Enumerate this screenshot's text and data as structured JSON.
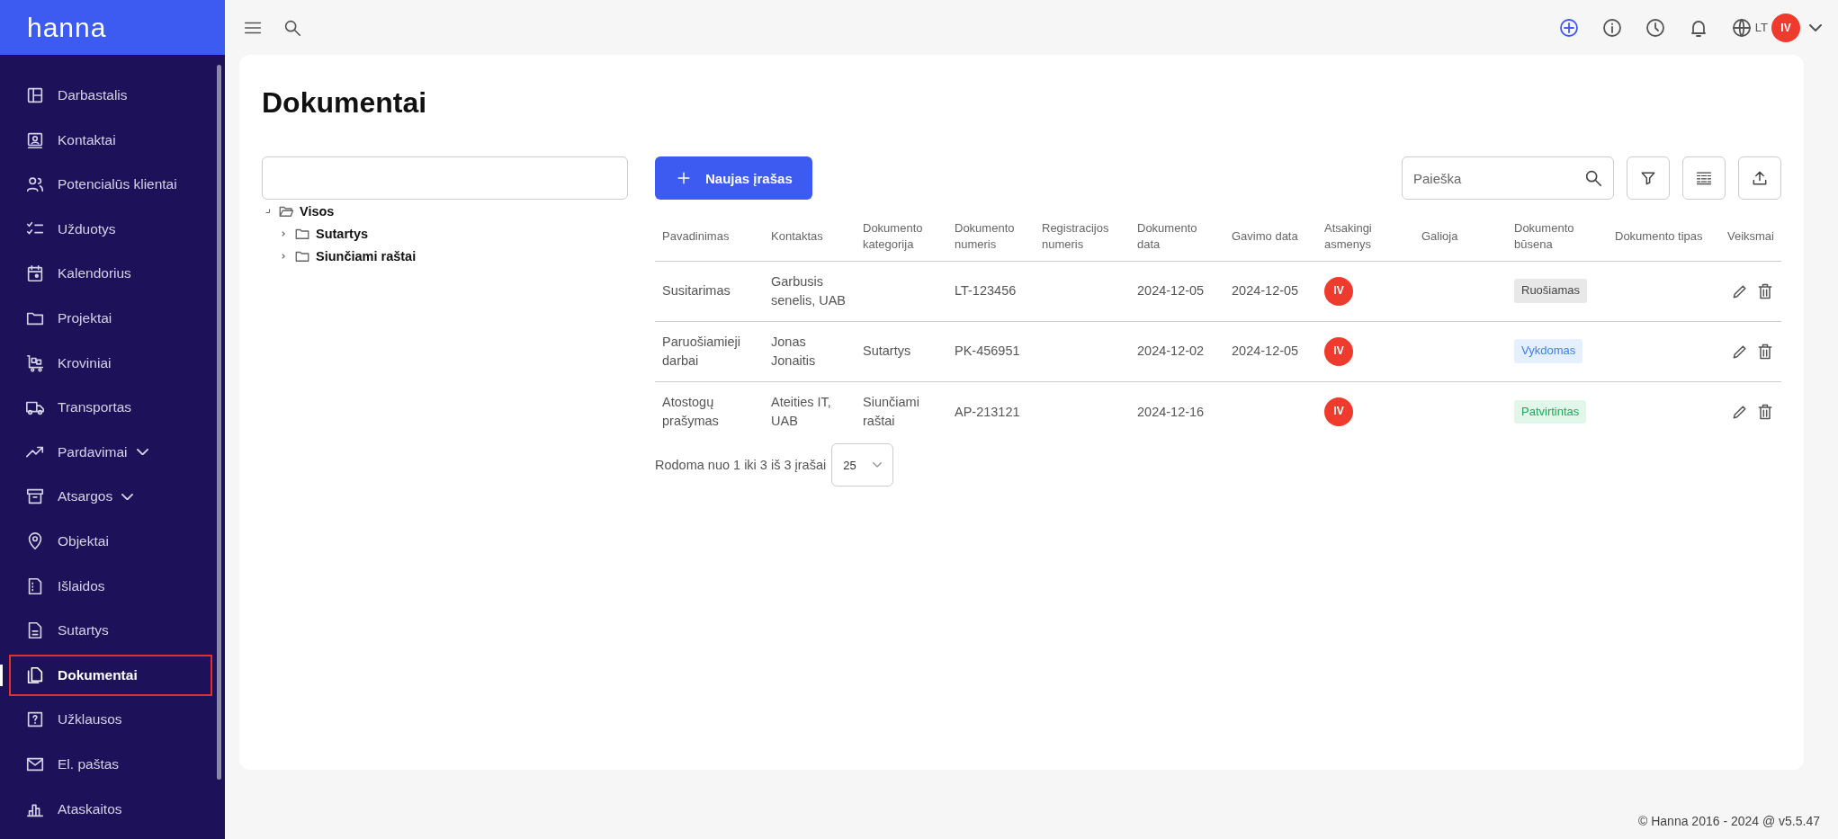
{
  "sidebar": {
    "logo": "hanna",
    "items": [
      {
        "label": "Darbastalis",
        "selected": false,
        "expandable": false
      },
      {
        "label": "Kontaktai",
        "selected": false,
        "expandable": false
      },
      {
        "label": "Potencialūs klientai",
        "selected": false,
        "expandable": false
      },
      {
        "label": "Užduotys",
        "selected": false,
        "expandable": false
      },
      {
        "label": "Kalendorius",
        "selected": false,
        "expandable": false
      },
      {
        "label": "Projektai",
        "selected": false,
        "expandable": false
      },
      {
        "label": "Kroviniai",
        "selected": false,
        "expandable": false
      },
      {
        "label": "Transportas",
        "selected": false,
        "expandable": false
      },
      {
        "label": "Pardavimai",
        "selected": false,
        "expandable": true
      },
      {
        "label": "Atsargos",
        "selected": false,
        "expandable": true
      },
      {
        "label": "Objektai",
        "selected": false,
        "expandable": false
      },
      {
        "label": "Išlaidos",
        "selected": false,
        "expandable": false
      },
      {
        "label": "Sutartys",
        "selected": false,
        "expandable": false
      },
      {
        "label": "Dokumentai",
        "selected": true,
        "expandable": false
      },
      {
        "label": "Užklausos",
        "selected": false,
        "expandable": false
      },
      {
        "label": "El. paštas",
        "selected": false,
        "expandable": false
      },
      {
        "label": "Ataskaitos",
        "selected": false,
        "expandable": false
      }
    ]
  },
  "topbar": {
    "language": "LT",
    "avatar": "IV"
  },
  "page": {
    "title": "Dokumentai"
  },
  "tree": [
    {
      "label": "Visos",
      "expanded": true,
      "children": [
        {
          "label": "Sutartys",
          "expanded": false
        },
        {
          "label": "Siunčiami raštai",
          "expanded": false
        }
      ]
    }
  ],
  "new_button": "Naujas įrašas",
  "search": {
    "placeholder": "Paieška"
  },
  "table": {
    "columns": [
      "Pavadinimas",
      "Kontaktas",
      "Dokumento kategorija",
      "Dokumento numeris",
      "Registracijos numeris",
      "Dokumento data",
      "Gavimo data",
      "Atsakingi asmenys",
      "Galioja",
      "Dokumento būsena",
      "Dokumento tipas",
      "Veiksmai"
    ],
    "rows": [
      {
        "name": "Susitarimas",
        "contact": "Garbusis senelis, UAB",
        "number": "LT-123456",
        "date": "2024-12-05",
        "received": "2024-12-05",
        "responsible": "IV",
        "status": {
          "label": "Ruošiamas",
          "kind": "draft"
        }
      },
      {
        "name": "Paruošiamieji darbai",
        "contact": "Jonas Jonaitis",
        "category": "Sutartys",
        "number": "PK-456951",
        "date": "2024-12-02",
        "received": "2024-12-05",
        "responsible": "IV",
        "status": {
          "label": "Vykdomas",
          "kind": "active"
        }
      },
      {
        "name": "Atostogų prašymas",
        "contact": "Ateities IT, UAB",
        "category": "Siunčiami raštai",
        "number": "AP-213121",
        "date": "2024-12-16",
        "responsible": "IV",
        "status": {
          "label": "Patvirtintas",
          "kind": "approved"
        }
      }
    ]
  },
  "pagination": {
    "summary": "Rodoma nuo 1 iki 3 iš 3 įrašai",
    "page_size": "25"
  },
  "footer": "© Hanna 2016 - 2024 @ v5.5.47"
}
